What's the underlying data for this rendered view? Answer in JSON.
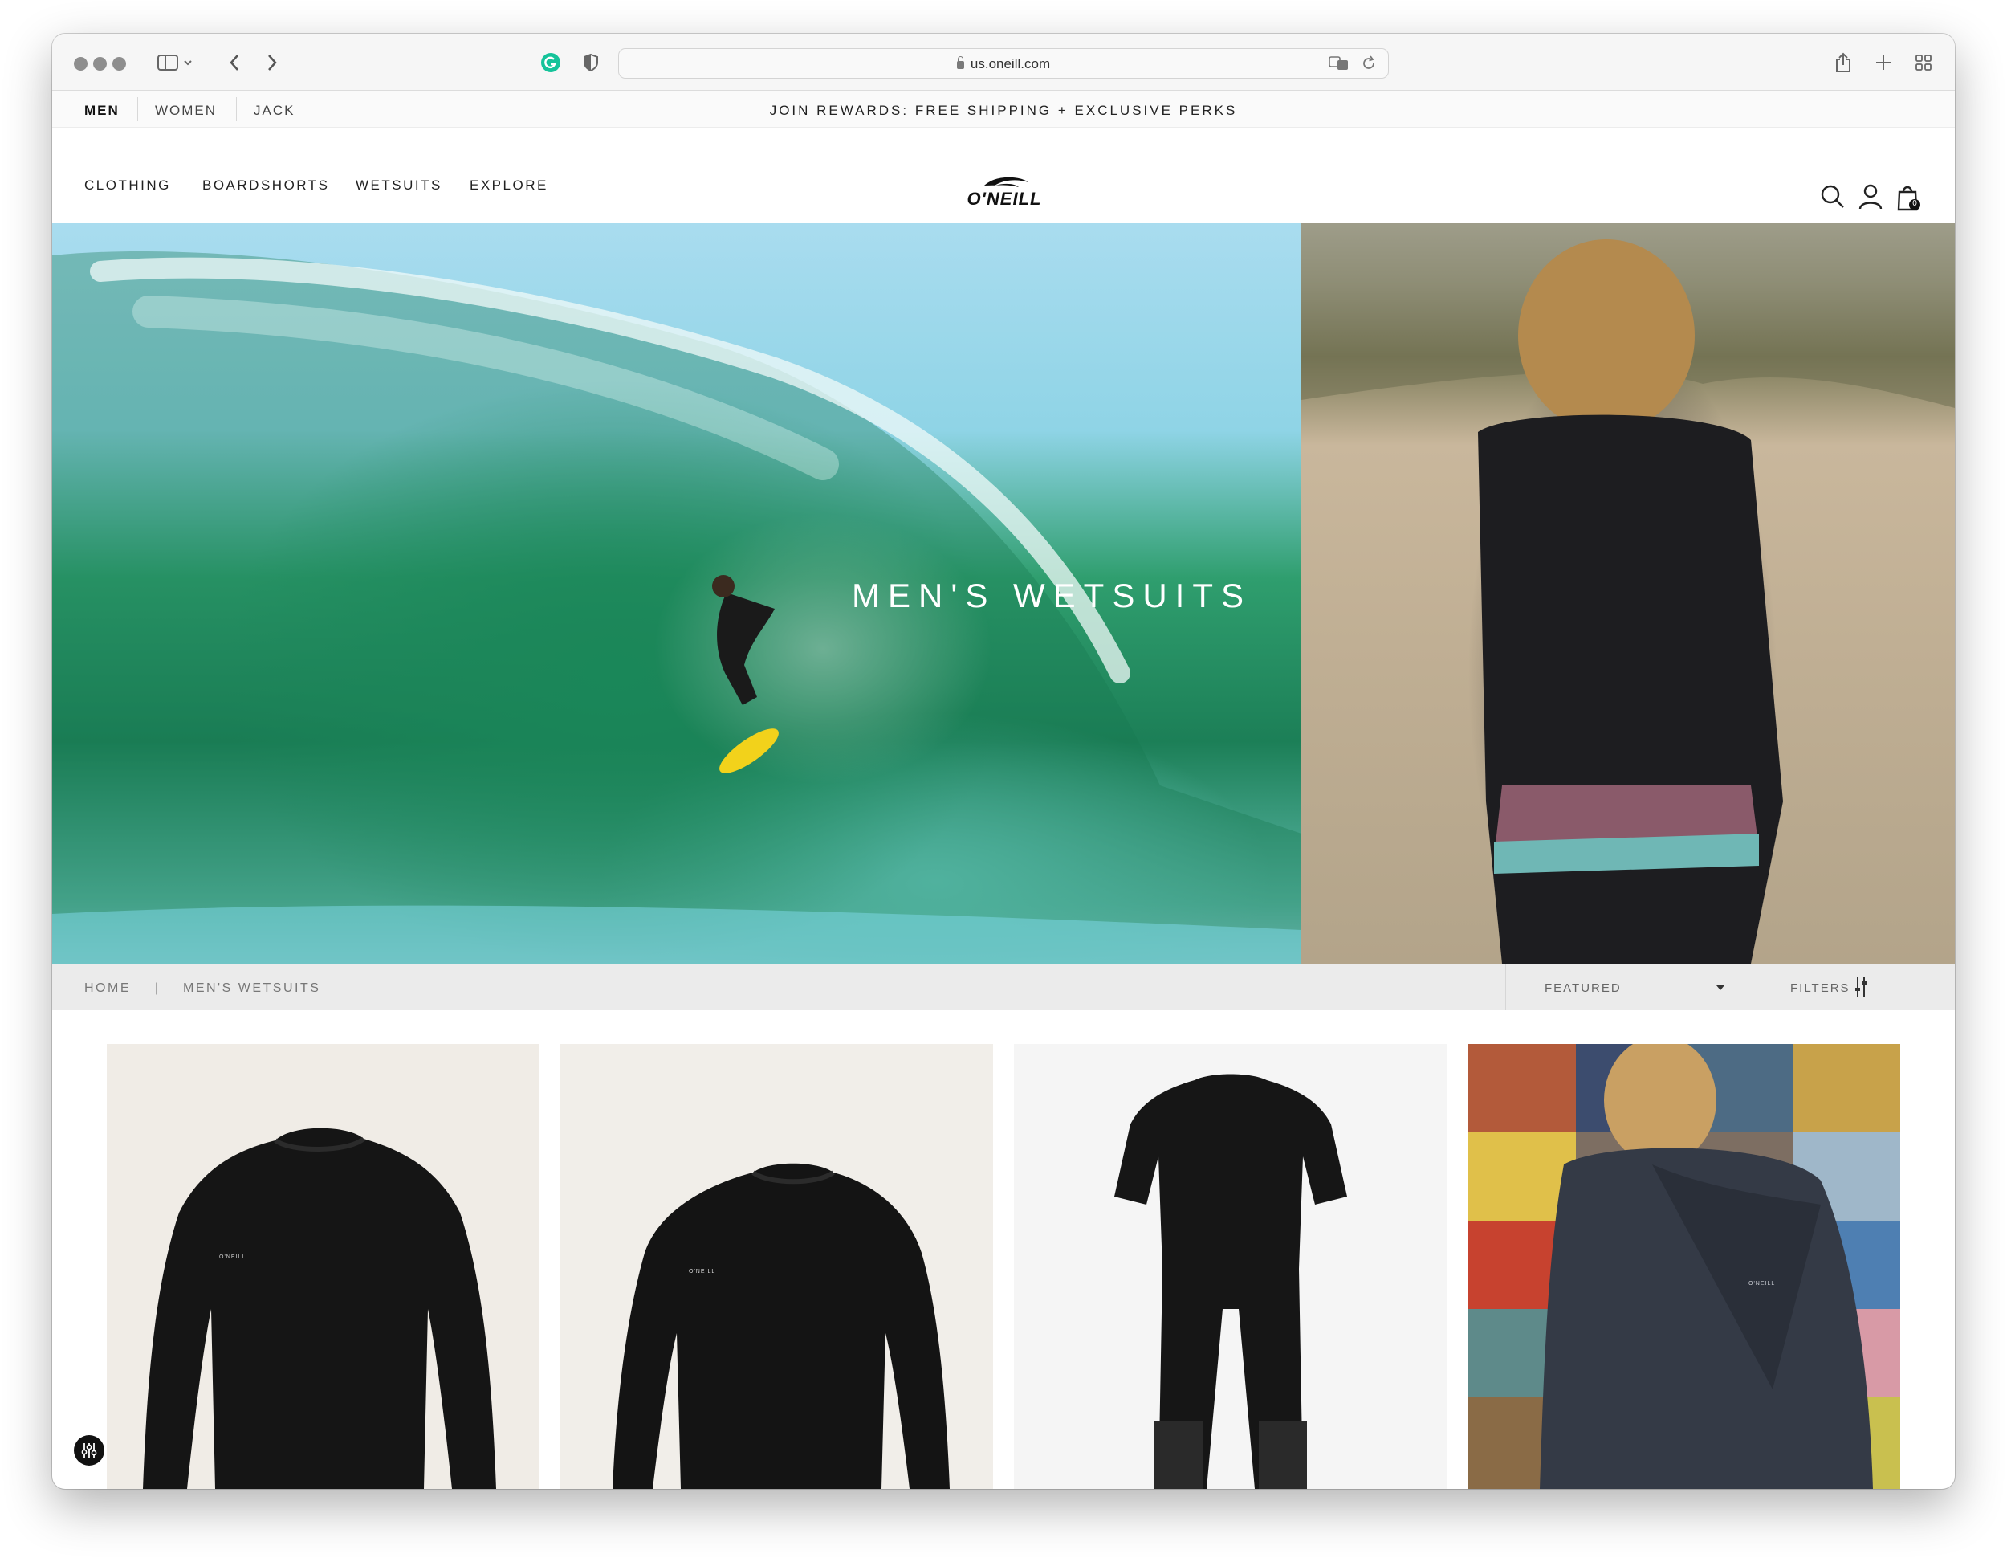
{
  "browser": {
    "url": "us.oneill.com"
  },
  "topbar": {
    "genders": [
      "MEN",
      "WOMEN",
      "JACK"
    ],
    "promo": "JOIN REWARDS: FREE SHIPPING + EXCLUSIVE PERKS"
  },
  "nav": {
    "items": [
      "CLOTHING",
      "BOARDSHORTS",
      "WETSUITS",
      "EXPLORE"
    ],
    "logo_text": "O'NEILL",
    "cart_count": "0"
  },
  "hero": {
    "title": "MEN'S WETSUITS"
  },
  "breadcrumb": {
    "home": "HOME",
    "separator": "|",
    "current": "MEN'S WETSUITS"
  },
  "sort": {
    "selected": "FEATURED"
  },
  "filters": {
    "label": "FILTERS"
  },
  "products": [
    {
      "kind": "long-sleeve top",
      "chest_logo": "O'NEILL"
    },
    {
      "kind": "long-sleeve top",
      "chest_logo": "O'NEILL"
    },
    {
      "kind": "short-sleeve springsuit"
    },
    {
      "kind": "full wetsuit on model",
      "chest_logo": "O'NEILL"
    }
  ],
  "colors": {
    "accent_text": "#222222",
    "breadcrumb_bg": "#ebebeb",
    "grammarly": "#15c39a"
  }
}
